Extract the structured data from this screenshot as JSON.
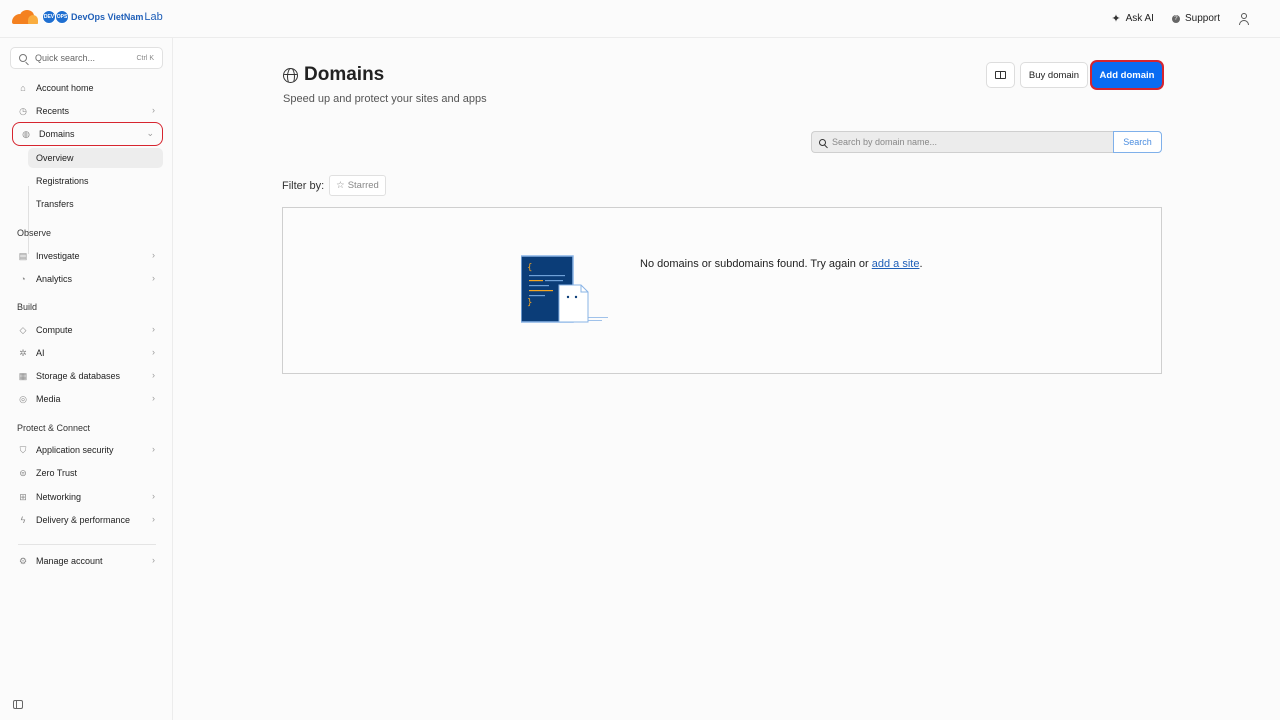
{
  "header": {
    "logo_badges": [
      "DEV",
      "OPS"
    ],
    "brand_name": "DevOps VietNam",
    "brand_suffix": "Lab",
    "ask_ai": "Ask AI",
    "support": "Support",
    "icons": [
      "sparkle-icon",
      "help-icon",
      "user-icon"
    ]
  },
  "sidebar": {
    "search_placeholder": "Quick search...",
    "search_shortcut": "Ctrl K",
    "items": {
      "account_home": "Account home",
      "recents": "Recents",
      "domains": "Domains",
      "overview": "Overview",
      "registrations": "Registrations",
      "transfers": "Transfers",
      "observe": "Observe",
      "investigate": "Investigate",
      "analytics": "Analytics",
      "build": "Build",
      "compute": "Compute",
      "ai": "AI",
      "storage": "Storage & databases",
      "media": "Media",
      "protect": "Protect & Connect",
      "app_security": "Application security",
      "zero_trust": "Zero Trust",
      "networking": "Networking",
      "delivery": "Delivery & performance",
      "manage_account": "Manage account"
    }
  },
  "main": {
    "title": "Domains",
    "subtitle": "Speed up and protect your sites and apps",
    "buy_domain": "Buy domain",
    "add_domain": "Add domain",
    "search_placeholder": "Search by domain name...",
    "search_button": "Search",
    "filter_label": "Filter by:",
    "starred": "Starred",
    "empty_text": "No domains or subdomains found. Try again or ",
    "empty_link": "add a site",
    "empty_end": "."
  },
  "colors": {
    "accent": "#0a6cf2",
    "highlight": "#d6252f",
    "brand_orange": "#f48120"
  }
}
